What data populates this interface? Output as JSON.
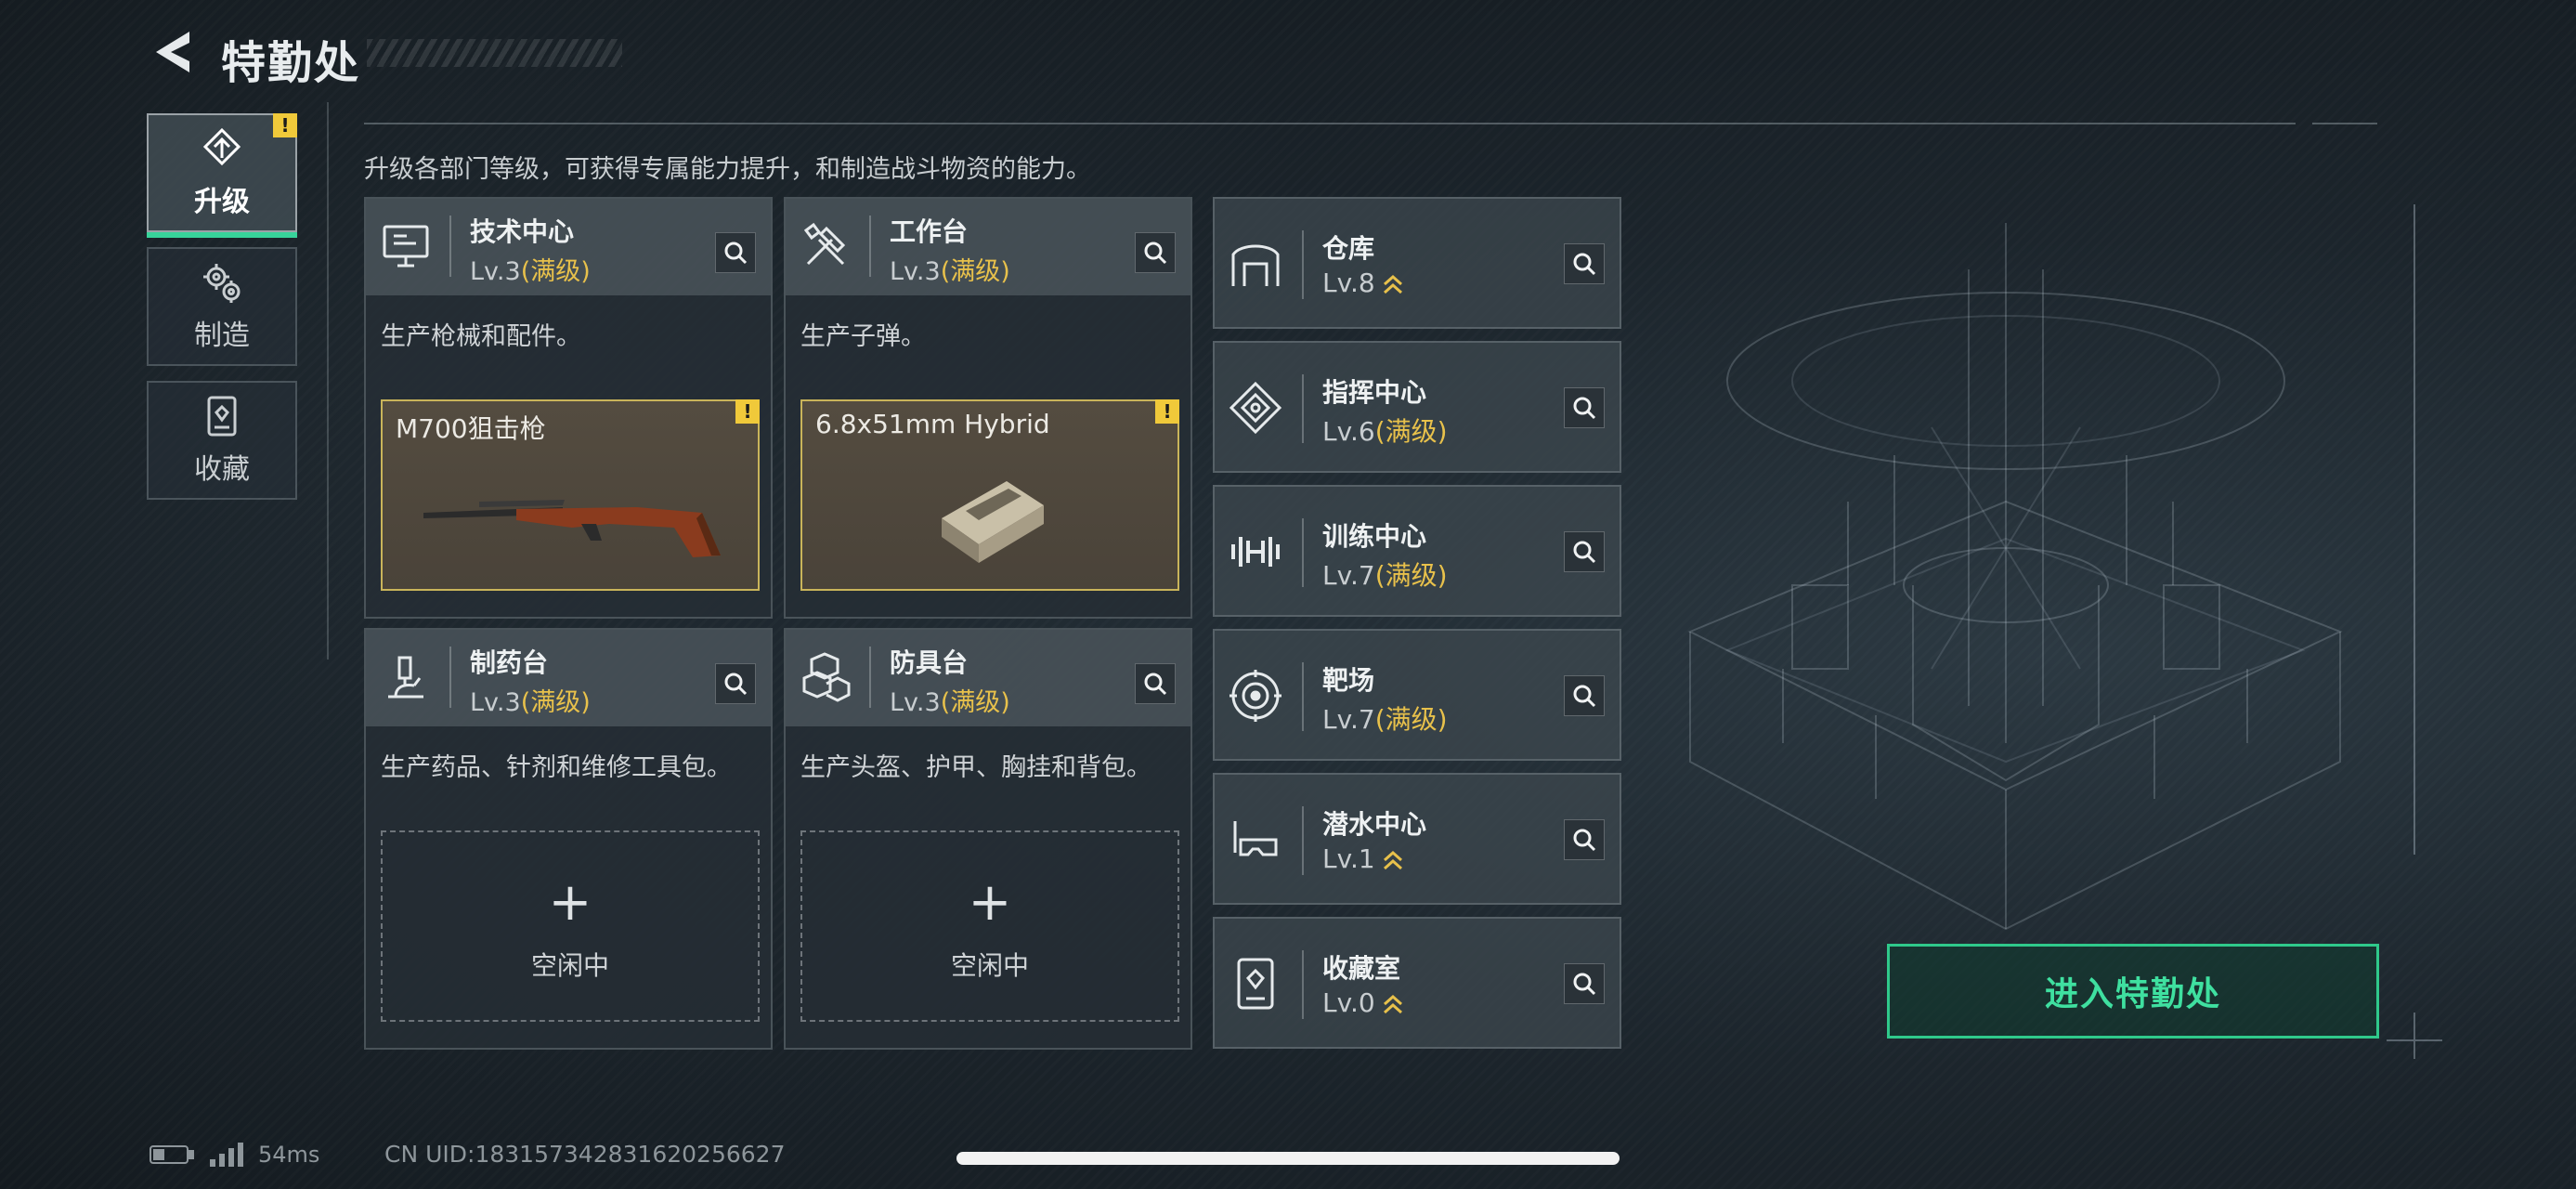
{
  "header": {
    "title": "特勤处"
  },
  "nav": [
    {
      "label": "升级",
      "icon": "upgrade-icon",
      "active": true,
      "warning": "!"
    },
    {
      "label": "制造",
      "icon": "gears-icon",
      "active": false
    },
    {
      "label": "收藏",
      "icon": "collection-icon",
      "active": false
    }
  ],
  "description": "升级各部门等级，可获得专属能力提升，和制造战斗物资的能力。",
  "cards": [
    {
      "name": "技术中心",
      "level": "Lv.3",
      "status": "(满级)",
      "desc": "生产枪械和配件。",
      "item": "M700狙击枪",
      "warning": "!",
      "icon": "computer-icon"
    },
    {
      "name": "工作台",
      "level": "Lv.3",
      "status": "(满级)",
      "desc": "生产子弹。",
      "item": "6.8x51mm Hybrid",
      "warning": "!",
      "icon": "tools-icon"
    },
    {
      "name": "制药台",
      "level": "Lv.3",
      "status": "(满级)",
      "desc": "生产药品、针剂和维修工具包。",
      "idle": "空闲中",
      "icon": "microscope-icon"
    },
    {
      "name": "防具台",
      "level": "Lv.3",
      "status": "(满级)",
      "desc": "生产头盔、护甲、胸挂和背包。",
      "idle": "空闲中",
      "icon": "armor-icon"
    }
  ],
  "facilities": [
    {
      "name": "仓库",
      "level": "Lv.8",
      "status": "",
      "icon": "warehouse-icon"
    },
    {
      "name": "指挥中心",
      "level": "Lv.6",
      "status": "(满级)",
      "icon": "command-icon"
    },
    {
      "name": "训练中心",
      "level": "Lv.7",
      "status": "(满级)",
      "icon": "dumbbell-icon"
    },
    {
      "name": "靶场",
      "level": "Lv.7",
      "status": "(满级)",
      "icon": "target-icon"
    },
    {
      "name": "潜水中心",
      "level": "Lv.1",
      "status": "",
      "icon": "diving-mask-icon"
    },
    {
      "name": "收藏室",
      "level": "Lv.0",
      "status": "",
      "icon": "collection-room-icon"
    }
  ],
  "enter_button": "进入特勤处",
  "footer": {
    "ping": "54ms",
    "uid": "CN UID:18315734283162025​6627"
  },
  "colors": {
    "accent": "#37d39a",
    "maxed": "#e8c14b",
    "warning": "#f0c93a"
  }
}
